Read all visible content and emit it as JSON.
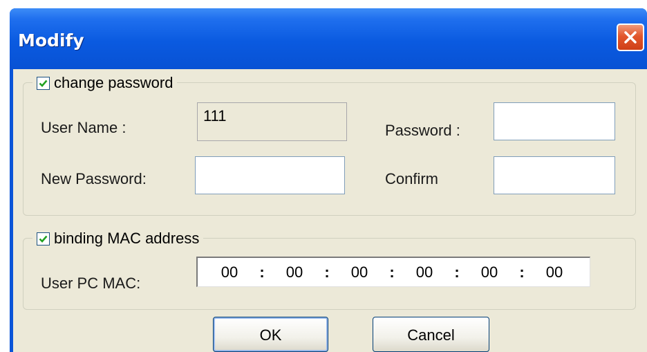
{
  "window": {
    "title": "Modify"
  },
  "change_password": {
    "label": "change password",
    "checked": true,
    "user_name_label": "User Name :",
    "user_name_value": "111",
    "password_label": "Password :",
    "password_value": "",
    "new_password_label": "New Password:",
    "new_password_value": "",
    "confirm_label": "Confirm",
    "confirm_value": ""
  },
  "binding_mac": {
    "label": "binding MAC address",
    "checked": true,
    "user_pc_mac_label": "User PC MAC:",
    "octets": [
      "00",
      "00",
      "00",
      "00",
      "00",
      "00"
    ],
    "separator": ":"
  },
  "buttons": {
    "ok": "OK",
    "cancel": "Cancel"
  },
  "icons": {
    "close": "close-icon",
    "check": "checkmark-icon"
  },
  "colors": {
    "titlebar": "#0a5ae0",
    "client": "#ece9d8",
    "close": "#e2572c",
    "check": "#21a121"
  }
}
